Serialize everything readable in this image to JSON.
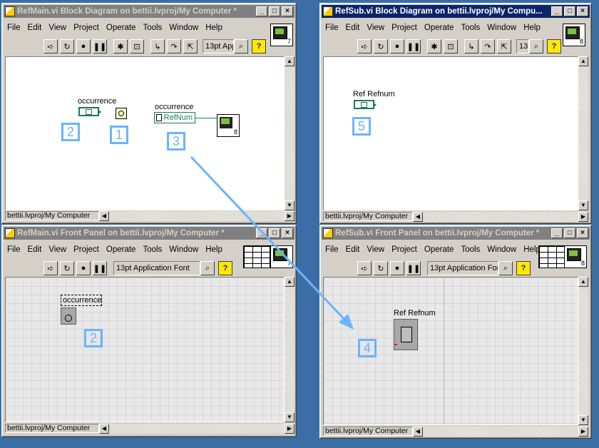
{
  "windows": {
    "main_bd": {
      "title": "RefMain.vi Block Diagram on bettii.lvproj/My Computer *",
      "font": "13pt Appl",
      "icon_number": "7",
      "status": "bettii.lvproj/My Computer",
      "occurrence_label": "occurrence",
      "occurrence_label2": "occurrence",
      "refnum_const": "RefNum",
      "subvi_number": "8",
      "callouts": [
        "2",
        "1",
        "3"
      ]
    },
    "sub_bd": {
      "title": "RefSub.vi Block Diagram on bettii.lvproj/My Compu...",
      "font": "13",
      "status": "bettii.lvproj/My Computer",
      "icon_number": "8",
      "ref_label": "Ref Refnum",
      "callout": "5"
    },
    "main_fp": {
      "title": "RefMain.vi Front Panel on bettii.lvproj/My Computer *",
      "font": "13pt Application Font",
      "status": "bettii.lvproj/My Computer",
      "icon_number": "7",
      "occurrence_label": "occurrence",
      "callout": "2"
    },
    "sub_fp": {
      "title": "RefSub.vi Front Panel on bettii.lvproj/My Computer *",
      "font": "13pt Application Fon",
      "status": "bettii.lvproj/My Computer",
      "icon_number": "8",
      "ref_label": "Ref Refnum",
      "callout": "4"
    }
  },
  "menu": [
    "File",
    "Edit",
    "View",
    "Project",
    "Operate",
    "Tools",
    "Window",
    "Help"
  ],
  "title_buttons": {
    "minimize": "_",
    "maximize": "□",
    "close": "×"
  },
  "help_glyph": "?",
  "colors": {
    "callout": "#6bb4ff",
    "active_title": "#0a246a",
    "inactive_title": "#808080",
    "refnum_wire": "#1a7a5a"
  }
}
